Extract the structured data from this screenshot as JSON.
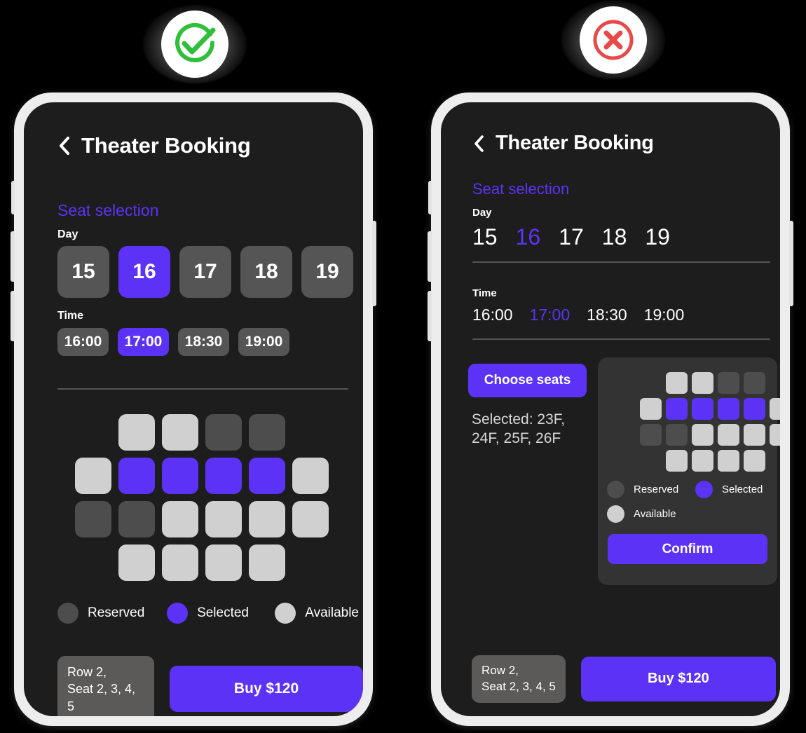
{
  "badges": [
    {
      "name": "success-badge",
      "icon": "check-circle-icon",
      "color": "#2fbf3a"
    },
    {
      "name": "error-badge",
      "icon": "x-circle-icon",
      "color": "#e84a4a"
    }
  ],
  "colors": {
    "accent": "#5c33f6",
    "screen_bg": "#1d1d1d",
    "frame": "#ededed",
    "chip_bg": "#555555",
    "seat_reserved": "#4d4d4d",
    "seat_selected": "#5c33f6",
    "seat_available": "#d0d0d0",
    "panel_bg": "#333333",
    "success": "#2fbf3a",
    "error": "#e84a4a"
  },
  "app": {
    "title": "Theater Booking",
    "back_icon": "chevron-left-icon",
    "section_title": "Seat selection",
    "day_label": "Day",
    "time_label": "Time",
    "days": [
      "15",
      "16",
      "17",
      "18",
      "19"
    ],
    "selected_day": "16",
    "times": [
      "16:00",
      "17:00",
      "18:30",
      "19:00"
    ],
    "selected_time": "17:00",
    "legend": [
      {
        "label": "Reserved",
        "state": "reserved"
      },
      {
        "label": "Selected",
        "state": "selected"
      },
      {
        "label": "Available",
        "state": "available"
      }
    ],
    "seat_info": "Row 2,\nSeat 2, 3, 4, 5",
    "buy_label": "Buy $120",
    "choose_seats_label": "Choose seats",
    "selected_seats_text": "Selected: 23F, 24F, 25F, 26F",
    "confirm_label": "Confirm",
    "seat_map": [
      [
        "empty",
        "available",
        "available",
        "reserved",
        "reserved",
        "empty"
      ],
      [
        "available",
        "selected",
        "selected",
        "selected",
        "selected",
        "available"
      ],
      [
        "reserved",
        "reserved",
        "available",
        "available",
        "available",
        "available"
      ],
      [
        "empty",
        "available",
        "available",
        "available",
        "available",
        "empty"
      ]
    ]
  }
}
